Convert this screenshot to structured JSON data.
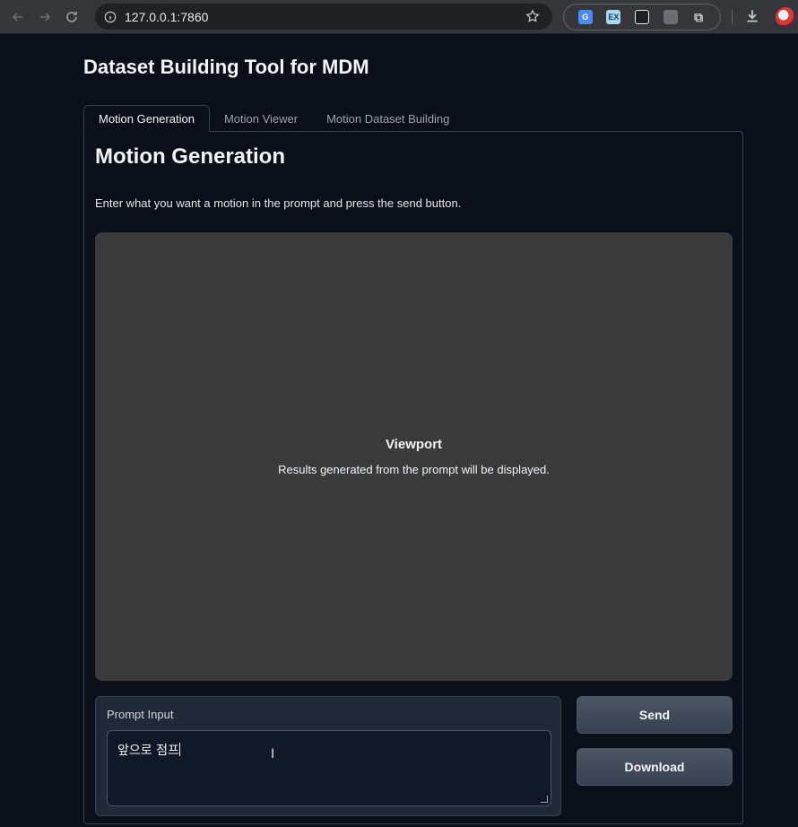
{
  "browser": {
    "url": "127.0.0.1:7860",
    "extensions": [
      "google-translate-icon",
      "ex-extension-icon",
      "grid-extension-icon",
      "window-extension-icon",
      "puzzle-icon"
    ],
    "ext_ex_label": "EX"
  },
  "app": {
    "title": "Dataset Building Tool for MDM"
  },
  "tabs": [
    {
      "label": "Motion Generation",
      "active": true
    },
    {
      "label": "Motion Viewer",
      "active": false
    },
    {
      "label": "Motion Dataset Building",
      "active": false
    }
  ],
  "main": {
    "section_title": "Motion Generation",
    "description": "Enter what you want a motion in the prompt and press the send button.",
    "viewport": {
      "title": "Viewport",
      "subtitle": "Results generated from the prompt will be displayed."
    },
    "prompt": {
      "label": "Prompt Input",
      "value": "앞으로 점프"
    },
    "buttons": {
      "send": "Send",
      "download": "Download"
    }
  }
}
